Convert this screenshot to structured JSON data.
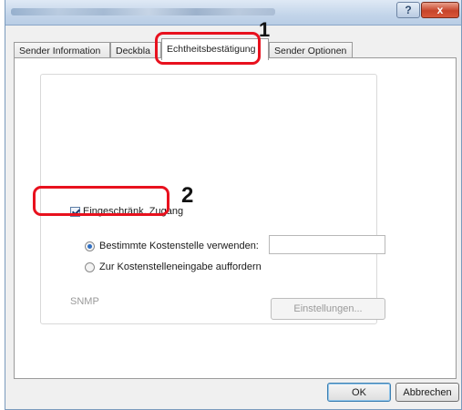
{
  "titlebar": {
    "help_label": "?",
    "close_label": "x"
  },
  "tabs": [
    {
      "label": "Sender Information"
    },
    {
      "label": "Deckbla"
    },
    {
      "label": "Echtheitsbestätigung",
      "selected": true
    },
    {
      "label": "Sender Optionen"
    }
  ],
  "panel": {
    "restricted_access": {
      "label": "Eingeschränk. Zugang",
      "checked": true
    },
    "radio_use_cost_center": {
      "label": "Bestimmte Kostenstelle verwenden:",
      "selected": true
    },
    "radio_prompt_cost_center": {
      "label": "Zur Kostenstelleneingabe auffordern",
      "selected": false
    },
    "cost_center_input_value": "",
    "snmp_label": "SNMP",
    "settings_button_label": "Einstellungen..."
  },
  "annotations": {
    "step1": "1",
    "step2": "2",
    "color": "#e8111e"
  },
  "footer": {
    "ok_label": "OK",
    "cancel_label": "Abbrechen"
  }
}
